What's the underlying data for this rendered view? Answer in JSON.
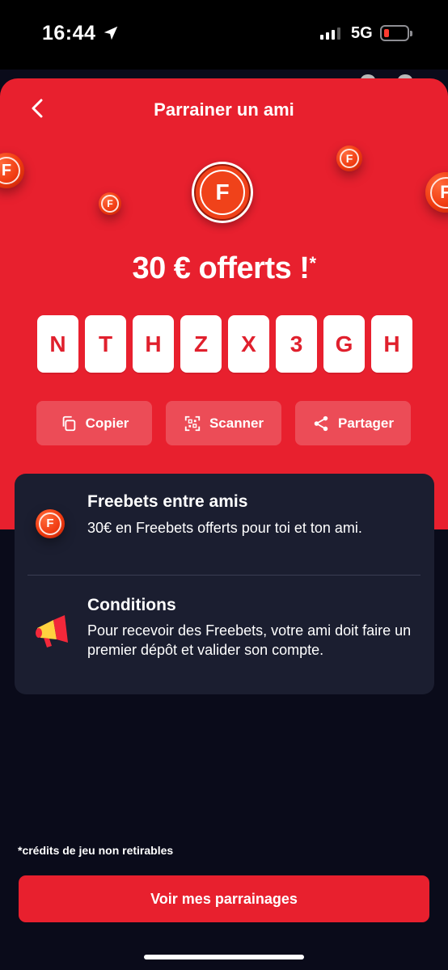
{
  "status_bar": {
    "time": "16:44",
    "network": "5G"
  },
  "header": {
    "title": "Parrainer un ami"
  },
  "logo": {
    "letter": "F"
  },
  "offer": {
    "headline": "30 € offerts !",
    "asterisk": "*"
  },
  "referral_code": [
    "N",
    "T",
    "H",
    "Z",
    "X",
    "3",
    "G",
    "H"
  ],
  "actions": [
    {
      "label": "Copier",
      "icon": "copy-icon"
    },
    {
      "label": "Scanner",
      "icon": "qr-scan-icon"
    },
    {
      "label": "Partager",
      "icon": "share-icon"
    }
  ],
  "info": {
    "freebets": {
      "title": "Freebets entre amis",
      "description": "30€ en Freebets offerts pour toi et ton ami.",
      "icon": "coin-icon"
    },
    "conditions": {
      "title": "Conditions",
      "description": "Pour recevoir des Freebets, votre ami doit faire un premier dépôt et valider son compte.",
      "icon": "megaphone-icon"
    }
  },
  "footnote": "*crédits de jeu non retirables",
  "cta": {
    "label": "Voir mes parrainages"
  },
  "colors": {
    "brand_red": "#e8202e",
    "background": "#0a0b1a",
    "card": "#1b1e30"
  }
}
